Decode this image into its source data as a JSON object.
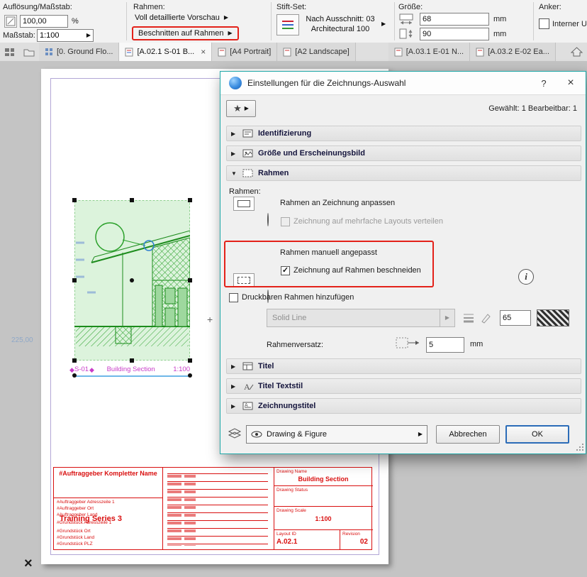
{
  "icons": {
    "caret_right": "▶",
    "caret_down": "▼",
    "star": "★",
    "close": "×",
    "help": "?",
    "check": "✓",
    "diamond": "◆",
    "plus": "+",
    "cross": "×"
  },
  "toolbar": {
    "res_label": "Auflösung/Maßstab:",
    "res_value": "100,00",
    "res_unit": "%",
    "scale_label": "Maßstab:",
    "scale_value": "1:100",
    "frame_label": "Rahmen:",
    "frame_preview": "Voll detaillierte Vorschau",
    "frame_clip": "Beschnitten auf Rahmen",
    "pen_label": "Stift-Set:",
    "pen_value1": "Nach Ausschnitt: 03",
    "pen_value2": "Architectural 100",
    "size_label": "Größe:",
    "size_w": "68",
    "size_h": "90",
    "unit_mm": "mm",
    "anchor_label": "Anker:",
    "anchor_text": "Interner Ursp"
  },
  "tabs": [
    {
      "label": "[0. Ground Flo..."
    },
    {
      "label": "[A.02.1 S-01 B..."
    },
    {
      "label": "[A4 Portrait]"
    },
    {
      "label": "[A2 Landscape]"
    },
    {
      "label": "[A.03.1 E-01 N..."
    },
    {
      "label": "[A.03.2 E-02 Ea..."
    }
  ],
  "canvas": {
    "dim_text": "225,00",
    "title_id": "S-01",
    "title_name": "Building Section",
    "title_scale": "1:100",
    "tb": {
      "client_name": "#Auftraggeber Kompletter Name",
      "client_addr1": "#Auftraggeber Adresszeile 1",
      "client_city": "#Auftraggeber Ort",
      "client_country": "#Auftraggeber Land",
      "project": "Training Series 3",
      "site_addr1": "#Grundstück Adresszeile 1",
      "site_city": "#Grundstück Ort",
      "site_country": "#Grundstück Land",
      "site_zip": "#Grundstück PLZ",
      "dn_label": "Drawing Name",
      "dn_value": "Building Section",
      "ds_label": "Drawing Status",
      "dsc_label": "Drawing Scale",
      "dsc_value": "1:100",
      "li_label": "Layout ID",
      "li_value": "A.02.1",
      "rev_label": "Revision",
      "rev_value": "02"
    }
  },
  "dialog": {
    "title": "Einstellungen für die Zeichnungs-Auswahl",
    "selected": "Gewählt: 1 Bearbeitbar: 1",
    "sec_ident": "Identifizierung",
    "sec_size": "Größe und Erscheinungsbild",
    "sec_frame": "Rahmen",
    "sec_titel": "Titel",
    "sec_titelstil": "Titel Textstil",
    "sec_ztitel": "Zeichnungstitel",
    "frame_label": "Rahmen:",
    "opt_fit": "Rahmen an Zeichnung anpassen",
    "opt_spread": "Zeichnung auf mehrfache Layouts verteilen",
    "opt_manual": "Rahmen manuell angepasst",
    "opt_crop": "Zeichnung auf Rahmen beschneiden",
    "opt_printable": "Druckbaren Rahmen hinzufügen",
    "linetype": "Solid Line",
    "pen_no": "65",
    "offset_label": "Rahmenversatz:",
    "offset_value": "5",
    "offset_unit": "mm",
    "layer_combo": "Drawing & Figure",
    "cancel": "Abbrechen",
    "ok": "OK"
  },
  "colors": {
    "highlight_red": "#e32119",
    "drawing_green": "#1d8c1d",
    "selection_green_bg": "#dcf3dc",
    "title_magenta": "#c83cc8",
    "underline_blue": "#6fb7e8",
    "titleblock_red": "#d90f0f",
    "dialog_border_teal": "#1fa8a8",
    "ok_focus_blue": "#2b6cb8"
  }
}
